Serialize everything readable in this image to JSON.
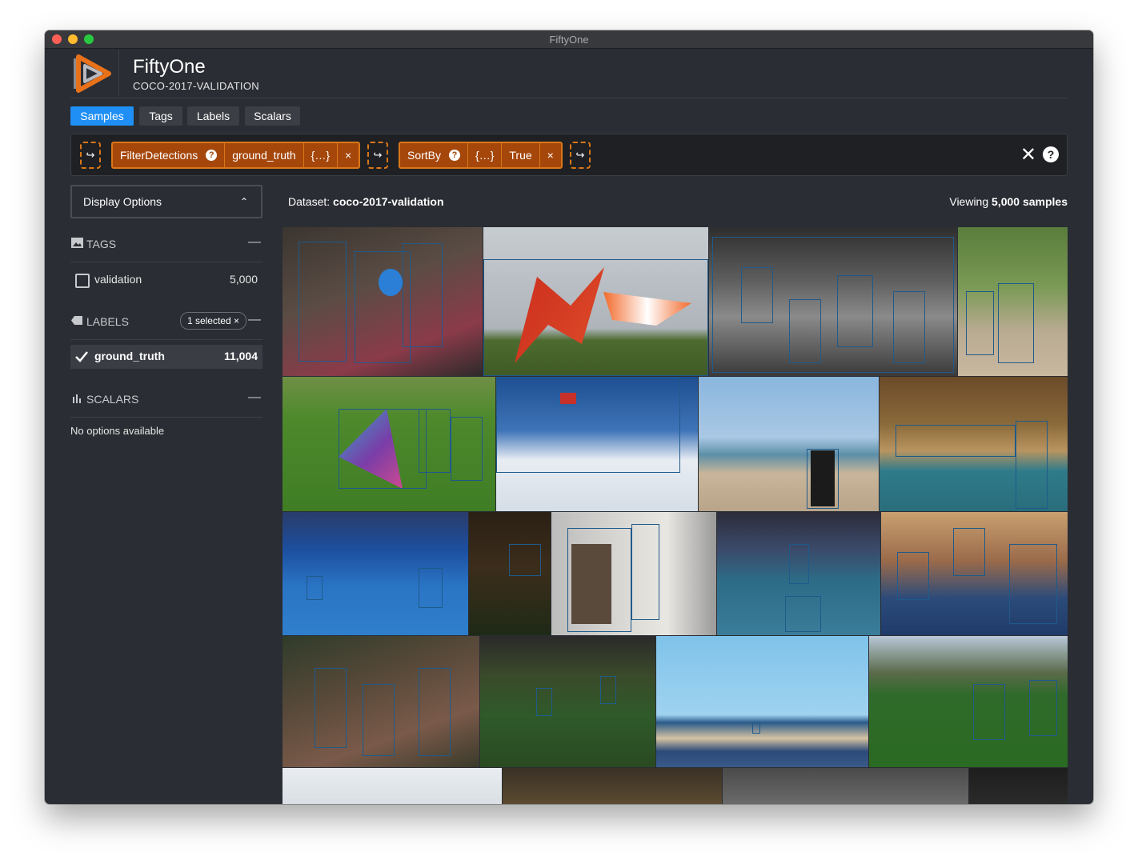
{
  "window": {
    "title": "FiftyOne"
  },
  "app": {
    "brand": "FiftyOne",
    "dataset_name": "COCO-2017-VALIDATION"
  },
  "tabs": [
    {
      "label": "Samples",
      "active": true
    },
    {
      "label": "Tags",
      "active": false
    },
    {
      "label": "Labels",
      "active": false
    },
    {
      "label": "Scalars",
      "active": false
    }
  ],
  "view_bar": {
    "add_stage_icon": "↪",
    "stages": [
      {
        "name": "FilterDetections",
        "params": [
          "ground_truth",
          "{…}"
        ],
        "help_icon": "?",
        "remove_icon": "×"
      },
      {
        "name": "SortBy",
        "params": [
          "{…}",
          "True"
        ],
        "help_icon": "?",
        "remove_icon": "×"
      }
    ],
    "clear_icon": "✕",
    "help_icon": "?"
  },
  "sidebar": {
    "display_options": "Display Options",
    "tags": {
      "title": "TAGS",
      "items": [
        {
          "label": "validation",
          "count": "5,000",
          "checked": false
        }
      ]
    },
    "labels": {
      "title": "LABELS",
      "selected_pill": "1 selected ×",
      "items": [
        {
          "label": "ground_truth",
          "count": "11,004",
          "checked": true
        }
      ]
    },
    "scalars": {
      "title": "SCALARS",
      "empty_text": "No options available"
    }
  },
  "main": {
    "dataset_label": "Dataset:",
    "dataset_value": "coco-2017-validation",
    "viewing_label": "Viewing",
    "viewing_value": "5,000 samples"
  },
  "colors": {
    "accent": "#1f8ff5",
    "stage_border": "#d97717",
    "stage_fill": "#a5470b",
    "background": "#2a2d33",
    "bbox": "#1f5a8a"
  },
  "icons": [
    "logo-icon",
    "tags-icon",
    "labels-icon",
    "scalars-icon",
    "check-icon",
    "chevron-up-icon",
    "close-icon",
    "help-icon",
    "add-stage-icon"
  ]
}
